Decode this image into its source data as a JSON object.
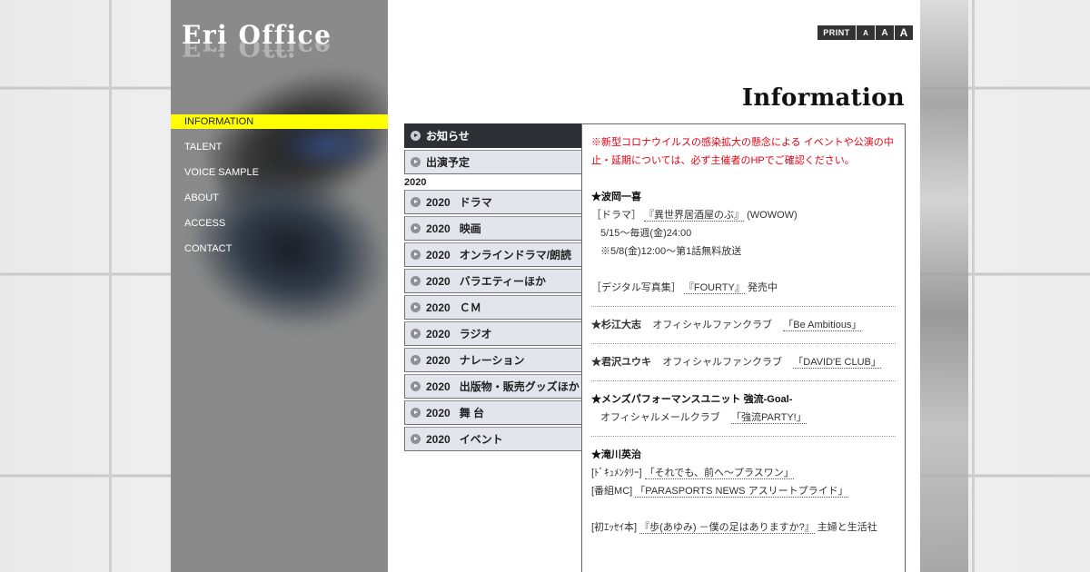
{
  "site": {
    "logo": "Eri Office"
  },
  "nav": {
    "items": [
      {
        "label": "INFORMATION"
      },
      {
        "label": "TALENT"
      },
      {
        "label": "VOICE SAMPLE"
      },
      {
        "label": "ABOUT"
      },
      {
        "label": "ACCESS"
      },
      {
        "label": "CONTACT"
      }
    ]
  },
  "tools": {
    "print": "PRINT",
    "font_small": "A",
    "font_medium": "A",
    "font_large": "A"
  },
  "page": {
    "heading": "Information"
  },
  "menu": {
    "top_items": [
      {
        "label": "お知らせ"
      },
      {
        "label": "出演予定"
      }
    ],
    "year": "2020",
    "year_items": [
      {
        "year": "2020",
        "label": "ドラマ"
      },
      {
        "year": "2020",
        "label": "映画"
      },
      {
        "year": "2020",
        "label": "オンラインドラマ/朗読"
      },
      {
        "year": "2020",
        "label": "バラエティーほか"
      },
      {
        "year": "2020",
        "label": "ＣＭ"
      },
      {
        "year": "2020",
        "label": "ラジオ"
      },
      {
        "year": "2020",
        "label": "ナレーション"
      },
      {
        "year": "2020",
        "label": "出版物・販売グッズほか"
      },
      {
        "year": "2020",
        "label": "舞 台"
      },
      {
        "year": "2020",
        "label": "イベント"
      }
    ]
  },
  "content": {
    "notice": "※新型コロナウイルスの感染拡大の懸念による イベントや公演の中止・延期については、必ず主催者のHPでご確認ください。",
    "hatanaka": {
      "name": "★波岡一喜",
      "drama_label": "［ドラマ］",
      "drama_title": "『異世界居酒屋のぶ』",
      "drama_network": "(WOWOW)",
      "drama_time": "5/15～毎週(金)24:00",
      "drama_note": "※5/8(金)12:00～第1話無料放送",
      "photo_label": "［デジタル写真集］",
      "photo_title": "『FOURTY』",
      "photo_suffix": "発売中"
    },
    "sugie": {
      "name": "★杉江大志",
      "desc": "オフィシャルファンクラブ",
      "link": "「Be Ambitious」"
    },
    "kimisawa": {
      "name": "★君沢ユウキ",
      "desc": "オフィシャルファンクラブ",
      "link": "「DAVID'E CLUB」"
    },
    "goal": {
      "name": "★メンズパフォーマンスユニット 強流-Goal-",
      "desc": "オフィシャルメールクラブ",
      "link": "「強流PARTY!」"
    },
    "takigawa": {
      "name": "★滝川英治",
      "doc_label": "[ﾄﾞｷｭﾒﾝﾀﾘｰ]",
      "doc_title": "「それでも、前へ〜プラスワン」",
      "prog_label": "[番組MC]",
      "prog_title": "「PARASPORTS NEWS アスリートプライド」",
      "essay_label": "[初ｴｯｾｲ本]",
      "essay_title": "『歩(あゆみ) －僕の足はありますか?』",
      "essay_publisher": "主婦と生活社"
    }
  },
  "colors": {
    "nav_active_bg": "#ffff00",
    "notice_text": "#e60012",
    "menu_current_bg": "#2d3035",
    "menu_item_bg": "#e2e5ec",
    "sidebar_bg": "#8a8a8a"
  }
}
